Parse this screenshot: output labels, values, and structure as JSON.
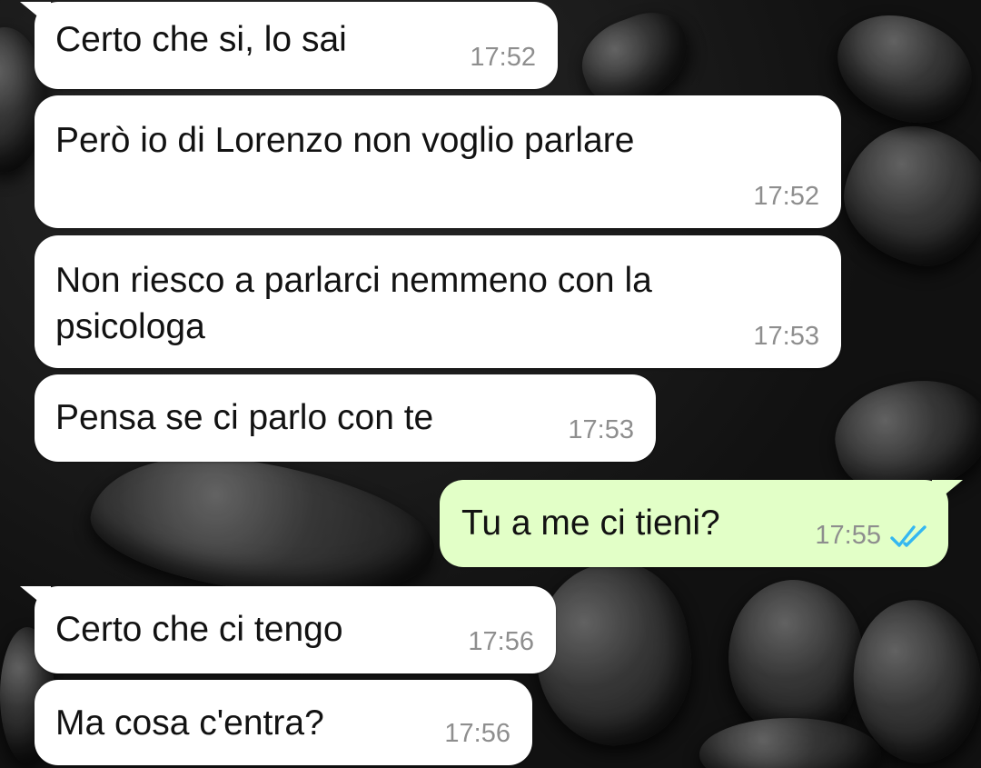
{
  "colors": {
    "incoming_bubble": "#ffffff",
    "outgoing_bubble": "#e2ffc7",
    "timestamp": "#8e8e8e",
    "read_ticks": "#34b7f1"
  },
  "messages": [
    {
      "direction": "in",
      "text": "Certo che si, lo sai",
      "time": "17:52"
    },
    {
      "direction": "in",
      "text": "Però io di Lorenzo non voglio parlare",
      "time": "17:52"
    },
    {
      "direction": "in",
      "text": "Non riesco a parlarci nemmeno con la\npsicologa",
      "time": "17:53"
    },
    {
      "direction": "in",
      "text": "Pensa se ci parlo con te",
      "time": "17:53"
    },
    {
      "direction": "out",
      "text": "Tu a me ci tieni?",
      "time": "17:55",
      "status_icon": "double-check-read-icon"
    },
    {
      "direction": "in",
      "text": "Certo che ci tengo",
      "time": "17:56"
    },
    {
      "direction": "in",
      "text": "Ma cosa c'entra?",
      "time": "17:56"
    }
  ]
}
